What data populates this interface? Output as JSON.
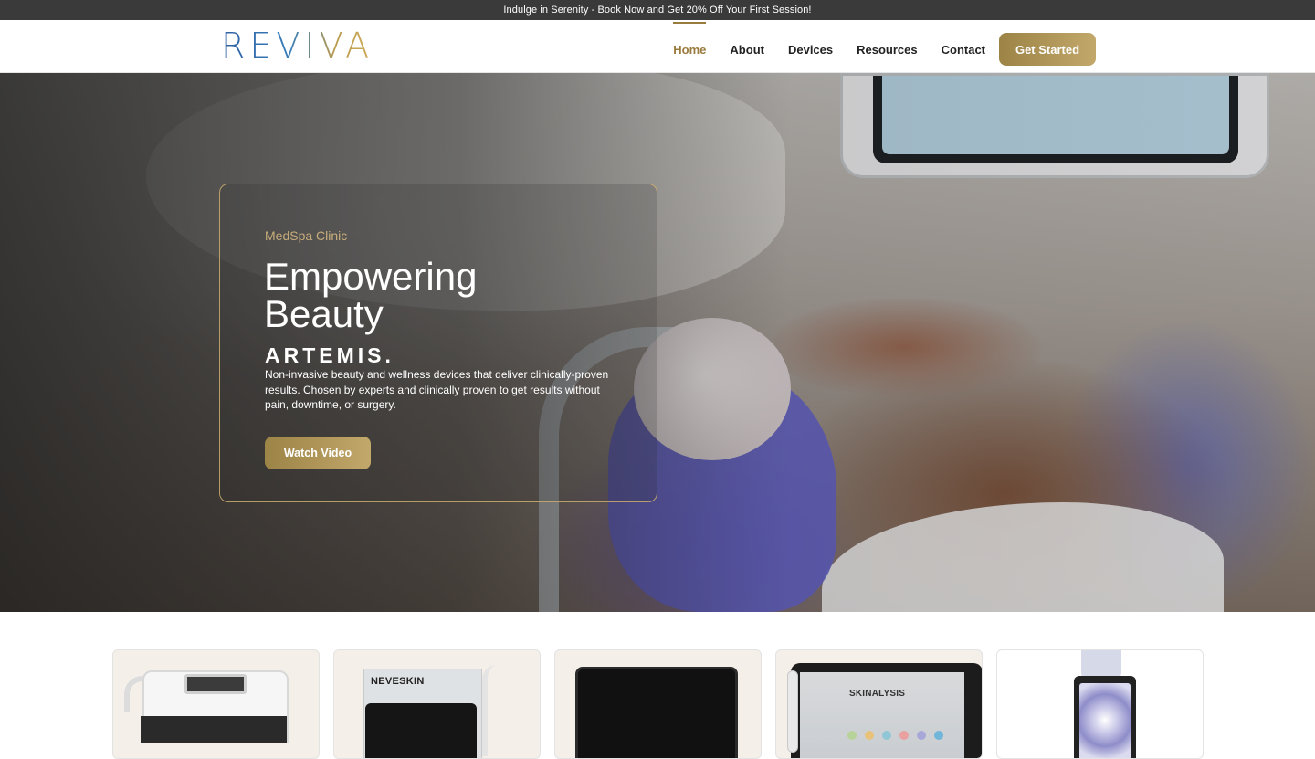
{
  "announcement": {
    "text": "Indulge in Serenity - Book Now and Get 20% Off Your First Session!"
  },
  "header": {
    "logo_text": "REVIVA",
    "nav": [
      {
        "label": "Home",
        "active": true
      },
      {
        "label": "About",
        "active": false
      },
      {
        "label": "Devices",
        "active": false
      },
      {
        "label": "Resources",
        "active": false
      },
      {
        "label": "Contact",
        "active": false
      }
    ],
    "cta_label": "Get Started"
  },
  "hero": {
    "kicker": "MedSpa Clinic",
    "title": "Empowering Beauty",
    "brand": "ARTEMIS.",
    "description": "Non-invasive beauty and wellness devices that deliver clinically-proven results. Chosen by experts and clinically proven to get results without pain, downtime, or surgery.",
    "button_label": "Watch Video"
  },
  "devices": {
    "cards": [
      {
        "name": "device-card-1"
      },
      {
        "name": "device-card-neveskin",
        "label": "NEVESKIN"
      },
      {
        "name": "device-card-3"
      },
      {
        "name": "device-card-skinalysis",
        "label": "SKINALYSIS"
      },
      {
        "name": "device-card-5"
      }
    ]
  },
  "colors": {
    "accent_gold": "#b39a5c",
    "announcement_bg": "#3a3a3a",
    "logo_blue": "#2f5fa3"
  }
}
